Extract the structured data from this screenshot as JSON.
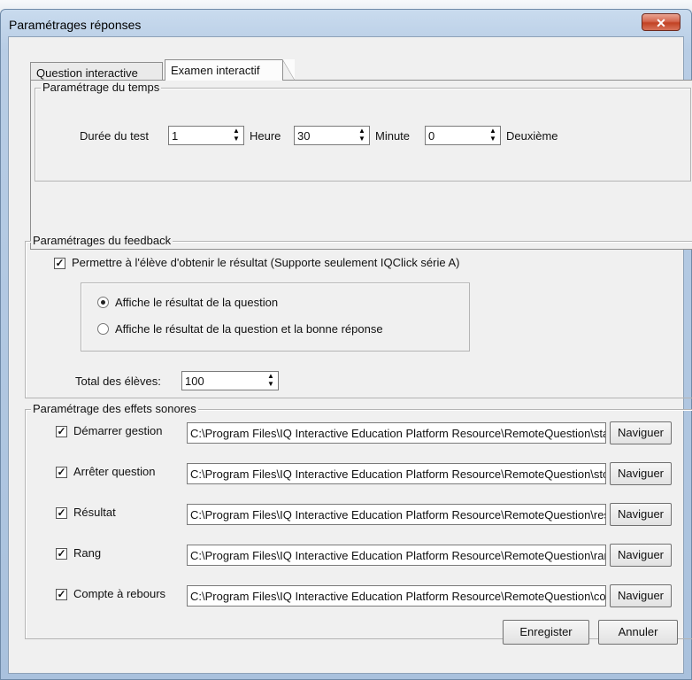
{
  "window": {
    "title": "Paramétrages réponses",
    "close_glyph": "✕"
  },
  "tabs": [
    {
      "label": "Question interactive",
      "active": false
    },
    {
      "label": "Examen interactif",
      "active": true
    }
  ],
  "time_settings": {
    "group_title": "Paramétrage du temps",
    "duration_label": "Durée du test",
    "hours_value": "1",
    "hours_unit": "Heure",
    "minutes_value": "30",
    "minutes_unit": "Minute",
    "seconds_value": "0",
    "seconds_unit": "Deuxième"
  },
  "feedback": {
    "group_title": "Paramétrages du feedback",
    "allow_result_label": "Permettre à l'élève d'obtenir le résultat (Supporte seulement IQClick série A)",
    "allow_result_checked": true,
    "options": [
      {
        "label": "Affiche le résultat de la question",
        "checked": true
      },
      {
        "label": "Affiche le résultat de la question et la bonne réponse",
        "checked": false
      }
    ],
    "total_label": "Total des élèves:",
    "total_value": "100"
  },
  "sound": {
    "group_title": "Paramétrage des effets sonores",
    "browse_label": "Naviguer",
    "items": [
      {
        "label": "Démarrer gestion",
        "checked": true,
        "path": "C:\\Program Files\\IQ Interactive Education Platform Resource\\RemoteQuestion\\start.wav"
      },
      {
        "label": "Arrêter question",
        "checked": true,
        "path": "C:\\Program Files\\IQ Interactive Education Platform Resource\\RemoteQuestion\\stop.wav"
      },
      {
        "label": "Résultat",
        "checked": true,
        "path": "C:\\Program Files\\IQ Interactive Education Platform Resource\\RemoteQuestion\\result.wav"
      },
      {
        "label": "Rang",
        "checked": true,
        "path": "C:\\Program Files\\IQ Interactive Education Platform Resource\\RemoteQuestion\\rank.wav"
      },
      {
        "label": "Compte à rebours",
        "checked": true,
        "path": "C:\\Program Files\\IQ Interactive Education Platform Resource\\RemoteQuestion\\countdown.wav"
      }
    ]
  },
  "footer": {
    "save_label": "Enregister",
    "cancel_label": "Annuler"
  },
  "glyphs": {
    "check": "✓",
    "spin_up": "▲",
    "spin_down": "▼"
  },
  "colors": {
    "window_frame": "#b8cde5",
    "close_button": "#c94a2e",
    "dialog_bg": "#f0f0f0"
  }
}
